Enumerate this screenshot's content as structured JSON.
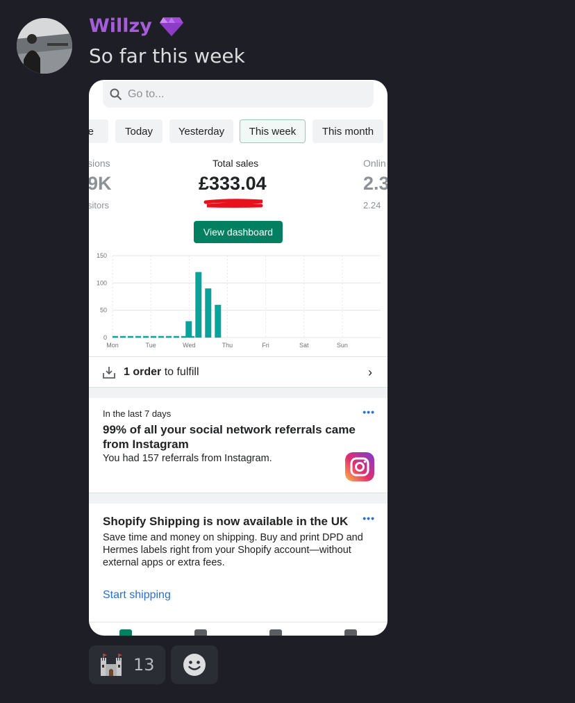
{
  "message": {
    "author": "Willzy",
    "author_color": "#a55ed8",
    "author_badge_icon": "gem-icon",
    "text": "So far this week"
  },
  "screenshot": {
    "search": {
      "placeholder": "Go to..."
    },
    "date_chips": [
      "ve",
      "Today",
      "Yesterday",
      "This week",
      "This month"
    ],
    "selected_chip": "This week",
    "stats": {
      "left": {
        "label": "sions",
        "value": "9K",
        "sub": "sitors"
      },
      "center": {
        "label": "Total sales",
        "value": "£333.04"
      },
      "right": {
        "label": "Onlin",
        "value": "2.3",
        "sub": "2.24"
      }
    },
    "view_dashboard_label": "View dashboard",
    "fulfill": {
      "count_text": "1 order",
      "suffix": " to fulfill"
    },
    "insight_card": {
      "kicker": "In the last 7 days",
      "title": "99% of all your social network referrals came from Instagram",
      "body": "You had 157 referrals from Instagram.",
      "menu": "•••"
    },
    "shipping_card": {
      "title": "Shopify Shipping is now available in the UK",
      "body": "Save time and money on shipping. Buy and print DPD and Hermes labels right from your Shopify account—without external apps or extra fees.",
      "link": "Start shipping",
      "menu": "•••"
    }
  },
  "chart_data": {
    "type": "bar",
    "categories": [
      "Mon",
      "Tue",
      "Wed",
      "Thu",
      "Fri",
      "Sat",
      "Sun"
    ],
    "y_ticks": [
      0,
      50,
      100,
      150
    ],
    "ylim": [
      0,
      150
    ],
    "bar_color": "#0aa29a",
    "bars": [
      {
        "x": "Wed",
        "offset": 0,
        "value": 30
      },
      {
        "x": "Wed",
        "offset": 1,
        "value": 120
      },
      {
        "x": "Wed",
        "offset": 2,
        "value": 90
      },
      {
        "x": "Wed",
        "offset": 3,
        "value": 60
      }
    ],
    "grid": true
  },
  "reactions": [
    {
      "emoji": "castle",
      "count": "13"
    },
    {
      "emoji": "add-reaction"
    }
  ]
}
